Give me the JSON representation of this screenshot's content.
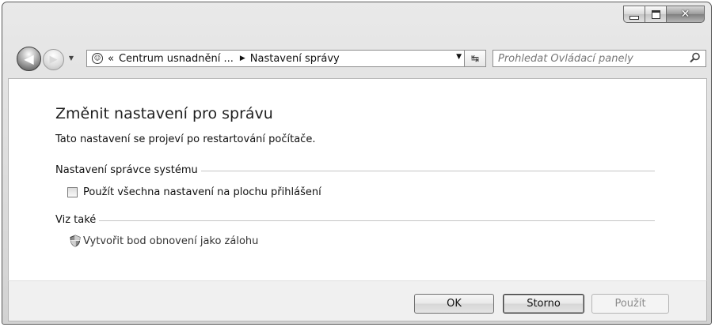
{
  "window": {
    "caption_buttons": [
      "minimize",
      "maximize",
      "close"
    ],
    "close_glyph": "✕"
  },
  "navigation": {
    "back_glyph": "◀",
    "forward_glyph": "▶",
    "history_dropdown": "▼"
  },
  "address_bar": {
    "chevrons": "«",
    "segments": [
      "Centrum usnadnění ...",
      "Nastavení správy"
    ],
    "separator": "▶",
    "dropdown": "▼",
    "refresh_glyph": "↹"
  },
  "search": {
    "placeholder": "Prohledat Ovládací panely"
  },
  "content": {
    "title": "Změnit nastavení pro správu",
    "description": "Tato nastavení se projeví po restartování počítače.",
    "section_admin": {
      "label": "Nastavení správce systému",
      "checkbox_label": "Použít všechna nastavení na plochu přihlášení",
      "checked": false
    },
    "section_see_also": {
      "label": "Viz také",
      "link_label": "Vytvořit bod obnovení jako zálohu"
    }
  },
  "buttons": {
    "ok": "OK",
    "cancel": "Storno",
    "apply": "Použít",
    "apply_enabled": false
  }
}
